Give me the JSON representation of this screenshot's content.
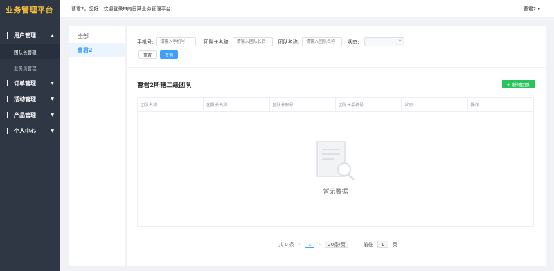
{
  "sidebar": {
    "logo": "业务管理平台",
    "menus": [
      {
        "label": "用户管理",
        "expanded": true,
        "children": [
          {
            "label": "团队长管理",
            "active": true
          },
          {
            "label": "业务员管理",
            "active": false
          }
        ]
      },
      {
        "label": "订单管理",
        "expanded": false
      },
      {
        "label": "活动管理",
        "expanded": false
      },
      {
        "label": "产品管理",
        "expanded": false
      },
      {
        "label": "个人中心",
        "expanded": false
      }
    ]
  },
  "header": {
    "welcome": "曹君2。您好！欢迎登录M向日葵业务管理平台！",
    "user": "曹君2 ▾"
  },
  "tree": {
    "nodes": [
      {
        "label": "全部",
        "active": false
      },
      {
        "label": "曹君2",
        "active": true
      }
    ]
  },
  "search": {
    "phone_label": "手机号:",
    "phone_placeholder": "请输入手机号",
    "leader_label": "团队长名称:",
    "leader_placeholder": "请输入团队长名",
    "team_label": "团队名称:",
    "team_placeholder": "请输入团队名称",
    "status_label": "状态:",
    "reset": "重置",
    "query": "查询"
  },
  "section": {
    "title": "曹君2所辖二级团队",
    "add_button": "＋ 新增团队"
  },
  "table": {
    "columns": [
      "团队名称",
      "团队长名称",
      "团队长账号",
      "团队长手机号",
      "状态",
      "操作"
    ],
    "rows": [],
    "empty_text": "暂无数据"
  },
  "pagination": {
    "total": "共 0 条",
    "prev": "‹",
    "current_page": "1",
    "next": "›",
    "page_size": "20条/页",
    "goto_label": "前往",
    "goto_value": "1",
    "page_unit": "页"
  }
}
